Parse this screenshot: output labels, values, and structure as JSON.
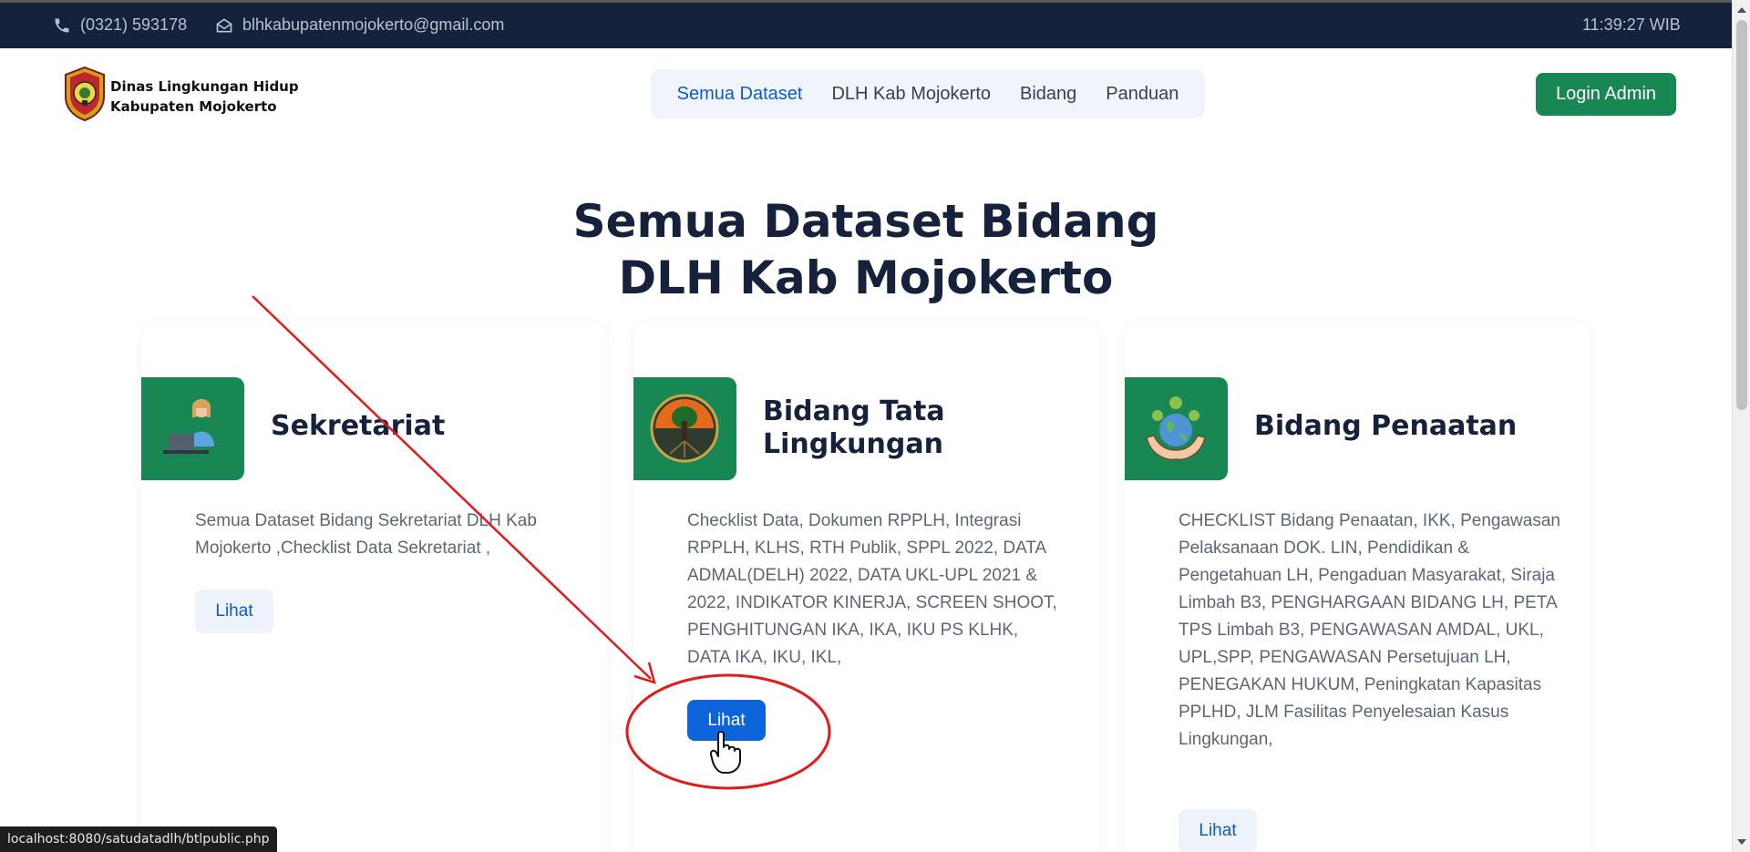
{
  "topbar": {
    "phone": "(0321) 593178",
    "email": "blhkabupatenmojokerto@gmail.com",
    "clock": "11:39:27 WIB"
  },
  "header": {
    "brand_line1": "Dinas Lingkungan Hidup",
    "brand_line2": "Kabupaten Mojokerto",
    "nav": [
      "Semua Dataset",
      "DLH Kab Mojokerto",
      "Bidang",
      "Panduan"
    ],
    "login_label": "Login Admin"
  },
  "main": {
    "title_line1": "Semua Dataset Bidang",
    "title_line2": "DLH Kab Mojokerto",
    "cards": [
      {
        "title": "Sekretariat",
        "description": "Semua Dataset Bidang Sekretariat DLH Kab Mojokerto ,Checklist Data Sekretariat ,",
        "button": "Lihat",
        "icon": "office-worker-icon"
      },
      {
        "title": "Bidang Tata Lingkungan",
        "description": "Checklist Data, Dokumen RPPLH, Integrasi RPPLH, KLHS, RTH Publik, SPPL 2022, DATA ADMAL(DELH) 2022, DATA UKL-UPL 2021 & 2022, INDIKATOR KINERJA, SCREEN SHOOT, PENGHITUNGAN IKA, IKA, IKU PS KLHK, DATA IKA, IKU, IKL,",
        "button": "Lihat",
        "icon": "tree-emblem-icon"
      },
      {
        "title": "Bidang Penaatan",
        "description": "CHECKLIST Bidang Penaatan, IKK, Pengawasan Pelaksanaan DOK. LIN, Pendidikan & Pengetahuan LH, Pengaduan Masyarakat, Siraja Limbah B3, PENGHARGAAN BIDANG LH, PETA TPS Limbah B3, PENGAWASAN AMDAL, UKL, UPL,SPP, PENGAWASAN Persetujuan LH, PENEGAKAN HUKUM, Peningkatan Kapasitas PPLHD, JLM Fasilitas Penyelesaian Kasus Lingkungan,",
        "button": "Lihat",
        "icon": "globe-in-hands-icon"
      }
    ]
  },
  "status_bar": {
    "url": "localhost:8080/satudatadlh/btlpublic.php"
  },
  "colors": {
    "topbar": "#16223b",
    "accent_green": "#198754",
    "link_blue": "#0d5bc6",
    "annotation_red": "#e31a1a"
  }
}
